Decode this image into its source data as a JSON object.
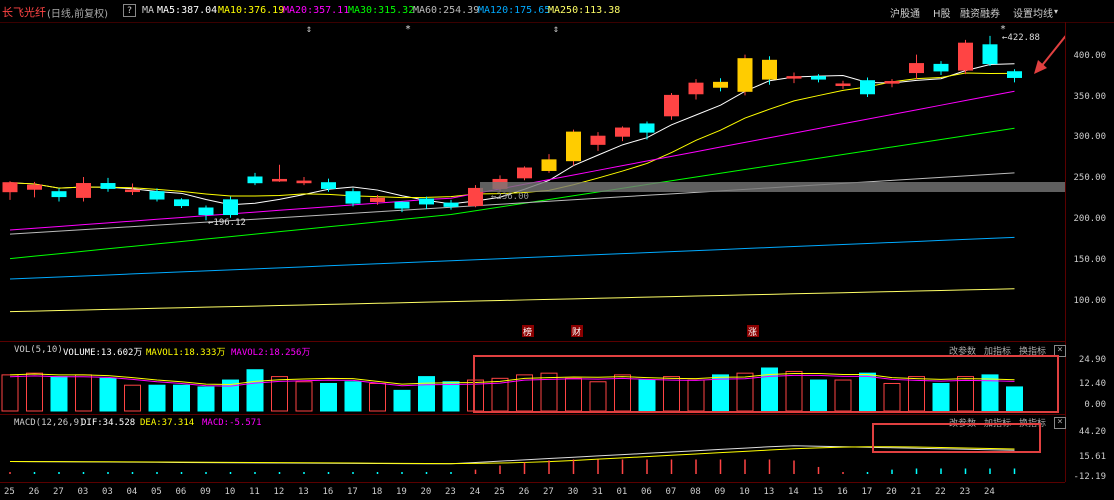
{
  "header": {
    "stock_name": "长飞光纤",
    "mode": "(日线,前复权)",
    "ma_label": "MA",
    "ma5": "MA5:387.04",
    "ma10": "MA10:376.19",
    "ma20": "MA20:357.11",
    "ma30": "MA30:315.32",
    "ma60": "MA60:254.39",
    "ma120": "MA120:175.65",
    "ma250": "MA250:113.38",
    "menu": [
      "沪股通",
      "H股",
      "融资融券",
      "设置均线"
    ]
  },
  "price_axis": [
    "400.00",
    "350.00",
    "300.00",
    "250.00",
    "200.00",
    "150.00",
    "100.00"
  ],
  "annotations": {
    "high_label": "422.88",
    "low_label": "196.12",
    "mid_label": "236.00",
    "event_tags": [
      "榜",
      "财",
      "涨"
    ]
  },
  "volume_panel": {
    "title": "VOL(5,10)",
    "volume": "VOLUME:13.602万",
    "mavol1": "MAVOL1:18.333万",
    "mavol2": "MAVOL2:18.256万",
    "axis": [
      "24.90",
      "12.40",
      "0.00"
    ],
    "buttons": [
      "改参数",
      "加指标",
      "换指标"
    ]
  },
  "macd_panel": {
    "title": "MACD(12,26,9)",
    "dif": "DIF:34.528",
    "dea": "DEA:37.314",
    "macd": "MACD:-5.571",
    "axis": [
      "44.20",
      "15.61",
      "-12.19"
    ],
    "buttons": [
      "改参数",
      "加指标",
      "换指标"
    ]
  },
  "date_axis": [
    "25",
    "26",
    "27",
    "03",
    "03",
    "04",
    "05",
    "06",
    "09",
    "10",
    "11",
    "12",
    "13",
    "16",
    "17",
    "18",
    "19",
    "20",
    "23",
    "24",
    "25",
    "26",
    "27",
    "30",
    "31",
    "01",
    "06",
    "07",
    "08",
    "09",
    "10",
    "13",
    "14",
    "15",
    "16",
    "17",
    "20",
    "21",
    "22",
    "23",
    "24"
  ],
  "colors": {
    "up": "#ff4444",
    "down": "#00ffff",
    "flat_up_fill": "#000000",
    "ma5": "#ffffff",
    "ma10": "#ffff00",
    "ma20": "#ff00ff",
    "ma30": "#00ff00",
    "ma60": "#bbbbbb",
    "ma120": "#00aaff",
    "ma250": "#ffff66",
    "highlight_box": "#e04040"
  }
}
